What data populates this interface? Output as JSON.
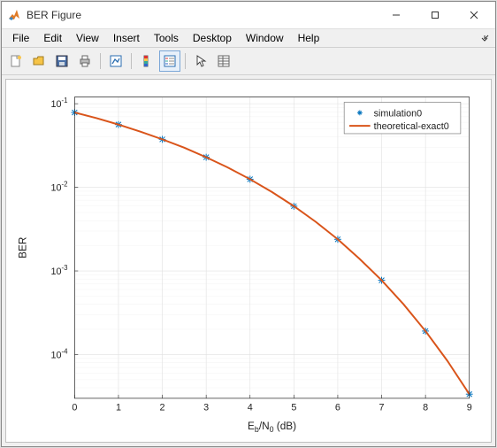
{
  "window": {
    "title": "BER Figure"
  },
  "menus": {
    "items": [
      "File",
      "Edit",
      "View",
      "Insert",
      "Tools",
      "Desktop",
      "Window",
      "Help"
    ]
  },
  "toolbar": {
    "buttons": [
      {
        "name": "new-figure",
        "icon": "new"
      },
      {
        "name": "open-file",
        "icon": "open"
      },
      {
        "name": "save-figure",
        "icon": "save"
      },
      {
        "name": "print-figure",
        "icon": "print"
      }
    ],
    "buttons2": [
      {
        "name": "link-plot",
        "icon": "link"
      }
    ],
    "buttons3": [
      {
        "name": "insert-colorbar",
        "icon": "colorbar"
      },
      {
        "name": "insert-legend",
        "icon": "legend",
        "selected": true
      }
    ],
    "buttons4": [
      {
        "name": "edit-plot",
        "icon": "arrow"
      },
      {
        "name": "open-property-inspector",
        "icon": "inspector"
      }
    ]
  },
  "chart_data": {
    "type": "line",
    "xlabel": "E_b/N_0 (dB)",
    "ylabel": "BER",
    "xlim": [
      0,
      9
    ],
    "ylim": [
      3e-05,
      0.12
    ],
    "yscale": "log",
    "xticks": [
      0,
      1,
      2,
      3,
      4,
      5,
      6,
      7,
      8,
      9
    ],
    "yticks": [
      0.0001,
      0.001,
      0.01,
      0.1
    ],
    "ytick_labels": [
      "10^{-4}",
      "10^{-3}",
      "10^{-2}",
      "10^{-1}"
    ],
    "series": [
      {
        "name": "simulation0",
        "style": "marker",
        "marker": "*",
        "color": "#0072BD",
        "x": [
          0,
          1,
          2,
          3,
          4,
          5,
          6,
          7,
          8,
          9
        ],
        "y": [
          0.0786,
          0.0563,
          0.0375,
          0.0229,
          0.0125,
          0.00595,
          0.00239,
          0.000773,
          0.000191,
          3.36e-05
        ]
      },
      {
        "name": "theoretical-exact0",
        "style": "line",
        "color": "#D9541A",
        "x": [
          0,
          0.5,
          1,
          1.5,
          2,
          2.5,
          3,
          3.5,
          4,
          4.5,
          5,
          5.5,
          6,
          6.5,
          7,
          7.5,
          8,
          8.5,
          9
        ],
        "y": [
          0.0786,
          0.0672,
          0.0563,
          0.0464,
          0.0375,
          0.0298,
          0.0229,
          0.0172,
          0.0125,
          0.00879,
          0.00595,
          0.00386,
          0.00239,
          0.00139,
          0.000773,
          0.000399,
          0.000191,
          8.4e-05,
          3.36e-05
        ]
      }
    ],
    "legend": {
      "entries": [
        "simulation0",
        "theoretical-exact0"
      ]
    }
  }
}
